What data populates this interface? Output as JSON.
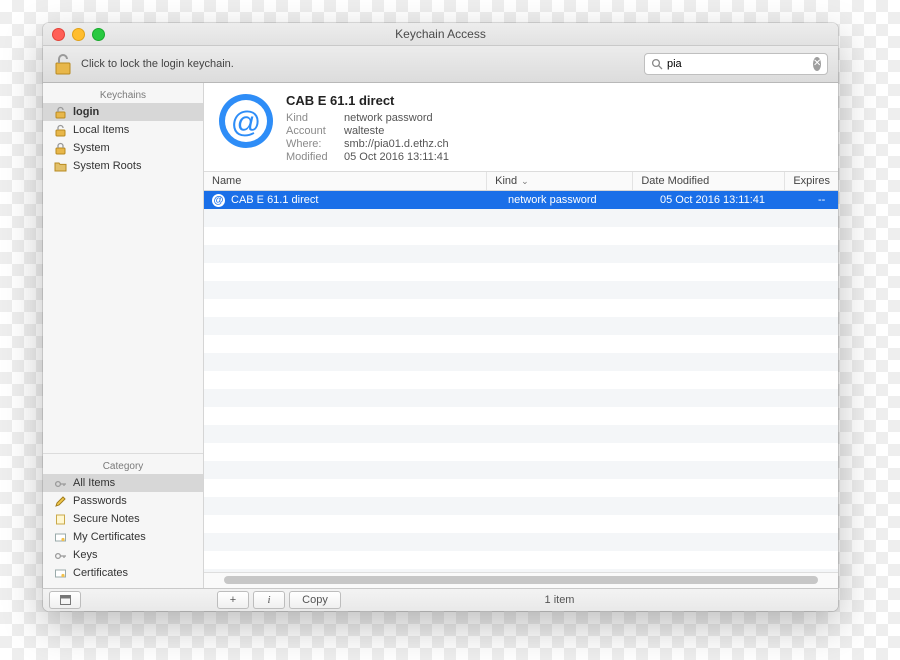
{
  "window": {
    "title": "Keychain Access"
  },
  "toolbar": {
    "lock_text": "Click to lock the login keychain.",
    "search_value": "pia",
    "search_placeholder": "Search"
  },
  "sidebar": {
    "keychains_header": "Keychains",
    "keychains": [
      {
        "label": "login",
        "icon": "unlocked"
      },
      {
        "label": "Local Items",
        "icon": "unlocked"
      },
      {
        "label": "System",
        "icon": "locked"
      },
      {
        "label": "System Roots",
        "icon": "folder"
      }
    ],
    "keychains_selected_index": 0,
    "category_header": "Category",
    "categories": [
      {
        "label": "All Items",
        "icon": "key"
      },
      {
        "label": "Passwords",
        "icon": "pencil"
      },
      {
        "label": "Secure Notes",
        "icon": "note"
      },
      {
        "label": "My Certificates",
        "icon": "cert"
      },
      {
        "label": "Keys",
        "icon": "key"
      },
      {
        "label": "Certificates",
        "icon": "cert"
      }
    ],
    "categories_selected_index": 0
  },
  "detail": {
    "name": "CAB E 61.1 direct",
    "fields": {
      "kind_label": "Kind",
      "kind_value": "network password",
      "account_label": "Account",
      "account_value": "walteste",
      "where_label": "Where:",
      "where_value": "smb://pia01.d.ethz.ch",
      "modified_label": "Modified",
      "modified_value": "05 Oct 2016 13:11:41"
    }
  },
  "table": {
    "columns": {
      "name": "Name",
      "kind": "Kind",
      "date": "Date Modified",
      "expires": "Expires"
    },
    "sort_column": "kind",
    "rows": [
      {
        "name": "CAB E 61.1 direct",
        "kind": "network password",
        "date": "05 Oct 2016 13:11:41",
        "expires": "--"
      }
    ],
    "selected_row": 0
  },
  "statusbar": {
    "add_label": "+",
    "info_label": "i",
    "copy_label": "Copy",
    "item_count_text": "1 item"
  },
  "colors": {
    "selection": "#1a6fe8"
  }
}
